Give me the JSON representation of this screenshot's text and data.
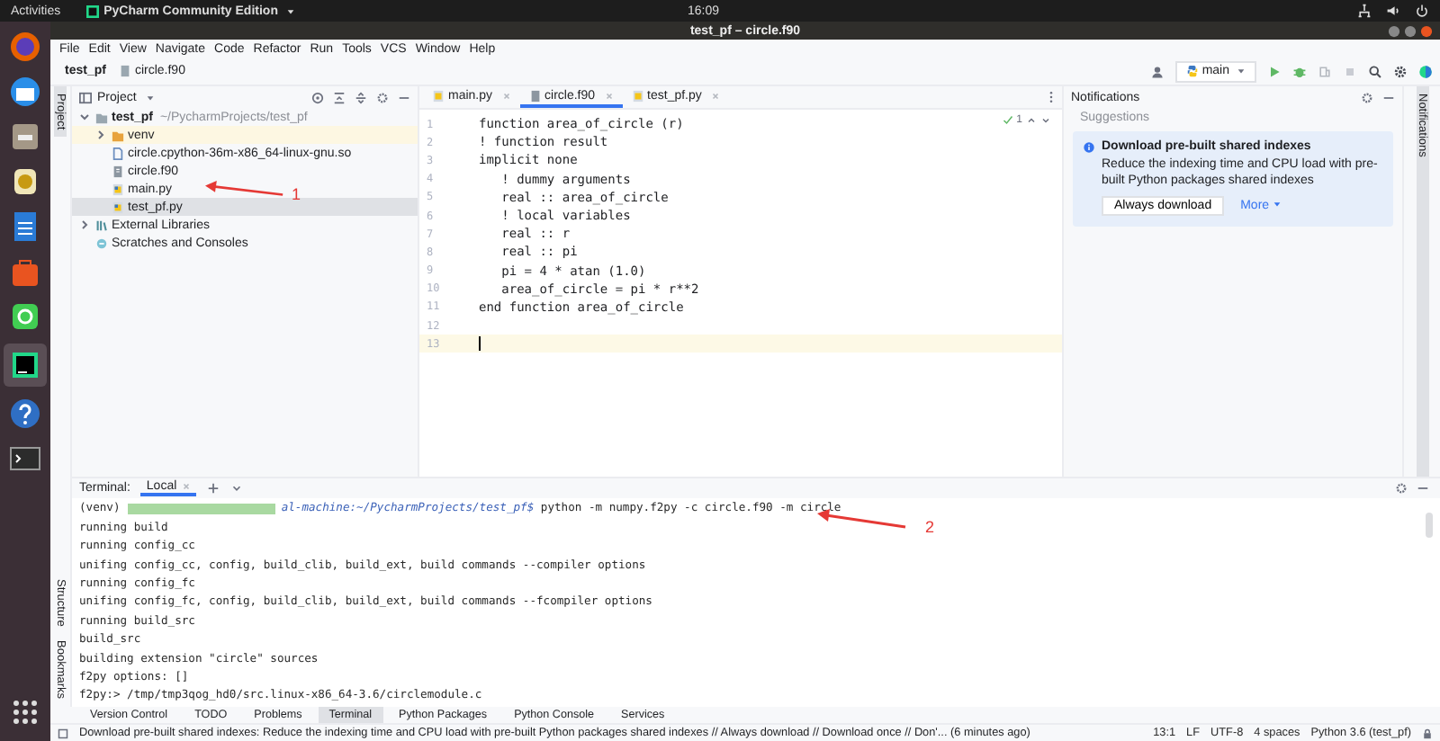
{
  "top_bar": {
    "activities": "Activities",
    "app_menu": "PyCharm Community Edition",
    "clock": "16:09"
  },
  "window": {
    "title": "test_pf – circle.f90"
  },
  "menu": [
    "File",
    "Edit",
    "View",
    "Navigate",
    "Code",
    "Refactor",
    "Run",
    "Tools",
    "VCS",
    "Window",
    "Help"
  ],
  "breadcrumb": [
    "test_pf",
    "circle.f90"
  ],
  "run_config": "main",
  "project": {
    "side_tab": "Project",
    "title": "Project",
    "annotation": "1",
    "tree": [
      {
        "label": "test_pf",
        "path": "~/PycharmProjects/test_pf",
        "kind": "folder",
        "expanded": true,
        "selected": false,
        "children": [
          {
            "label": "venv",
            "kind": "excluded",
            "expanded": false,
            "selected": false
          },
          {
            "label": "circle.cpython-36m-x86_64-linux-gnu.so",
            "kind": "binary",
            "selected": false
          },
          {
            "label": "circle.f90",
            "kind": "source",
            "selected": false
          },
          {
            "label": "main.py",
            "kind": "python",
            "selected": false
          },
          {
            "label": "test_pf.py",
            "kind": "python",
            "selected": true
          }
        ]
      },
      {
        "label": "External Libraries",
        "kind": "library",
        "expanded": false,
        "selected": false
      },
      {
        "label": "Scratches and Consoles",
        "kind": "scratch",
        "selected": false
      }
    ]
  },
  "editor": {
    "tabs": [
      {
        "label": "main.py",
        "kind": "python",
        "selected": false
      },
      {
        "label": "circle.f90",
        "kind": "source",
        "selected": true
      },
      {
        "label": "test_pf.py",
        "kind": "python",
        "selected": false
      }
    ],
    "inspection": "1",
    "lines": [
      {
        "number": "1",
        "code": "function area_of_circle (r)",
        "selected": false
      },
      {
        "number": "2",
        "code": "! function result",
        "selected": false
      },
      {
        "number": "3",
        "code": "implicit none",
        "selected": false
      },
      {
        "number": "4",
        "code": "   ! dummy arguments",
        "selected": false
      },
      {
        "number": "5",
        "code": "   real :: area_of_circle",
        "selected": false
      },
      {
        "number": "6",
        "code": "   ! local variables",
        "selected": false
      },
      {
        "number": "7",
        "code": "   real :: r",
        "selected": false
      },
      {
        "number": "8",
        "code": "   real :: pi",
        "selected": false
      },
      {
        "number": "9",
        "code": "   pi = 4 * atan (1.0)",
        "selected": false
      },
      {
        "number": "10",
        "code": "   area_of_circle = pi * r**2",
        "selected": false
      },
      {
        "number": "11",
        "code": "end function area_of_circle",
        "selected": false
      },
      {
        "number": "12",
        "selected": false
      },
      {
        "number": "13",
        "selected": true
      }
    ]
  },
  "notifications": {
    "title": "Notifications",
    "section": "Suggestions",
    "side_tab": "Notifications",
    "card": {
      "title": "Download pre-built shared indexes",
      "body": "Reduce the indexing time and CPU load with pre-built Python packages shared indexes",
      "button": "Always download",
      "link": "More"
    }
  },
  "terminal": {
    "title": "Terminal:",
    "tabs": [
      {
        "label": "Local",
        "selected": true
      }
    ],
    "annotation": "2",
    "prompt": {
      "env": "(venv)",
      "path": "al-machine:~/PycharmProjects/test_pf$",
      "command": "python -m numpy.f2py -c circle.f90 -m circle"
    },
    "lines": [
      "running build",
      "running config_cc",
      "unifing config_cc, config, build_clib, build_ext, build commands --compiler options",
      "running config_fc",
      "unifing config_fc, config, build_clib, build_ext, build commands --fcompiler options",
      "running build_src",
      "build_src",
      "building extension \"circle\" sources",
      "f2py options: []",
      "f2py:> /tmp/tmp3qog_hd0/src.linux-x86_64-3.6/circlemodule.c"
    ]
  },
  "side_tabs": [
    "Structure",
    "Bookmarks"
  ],
  "tool_windows": [
    {
      "label": "Version Control",
      "selected": false
    },
    {
      "label": "TODO",
      "selected": false
    },
    {
      "label": "Problems",
      "selected": false
    },
    {
      "label": "Terminal",
      "selected": true
    },
    {
      "label": "Python Packages",
      "selected": false
    },
    {
      "label": "Python Console",
      "selected": false
    },
    {
      "label": "Services",
      "selected": false
    }
  ],
  "status_bar": {
    "message": "Download pre-built shared indexes: Reduce the indexing time and CPU load with pre-built Python packages shared indexes // Always download // Download once // Don'... (6 minutes ago)",
    "items": [
      "13:1",
      "LF",
      "UTF-8",
      "4 spaces",
      "Python 3.6 (test_pf)"
    ]
  }
}
